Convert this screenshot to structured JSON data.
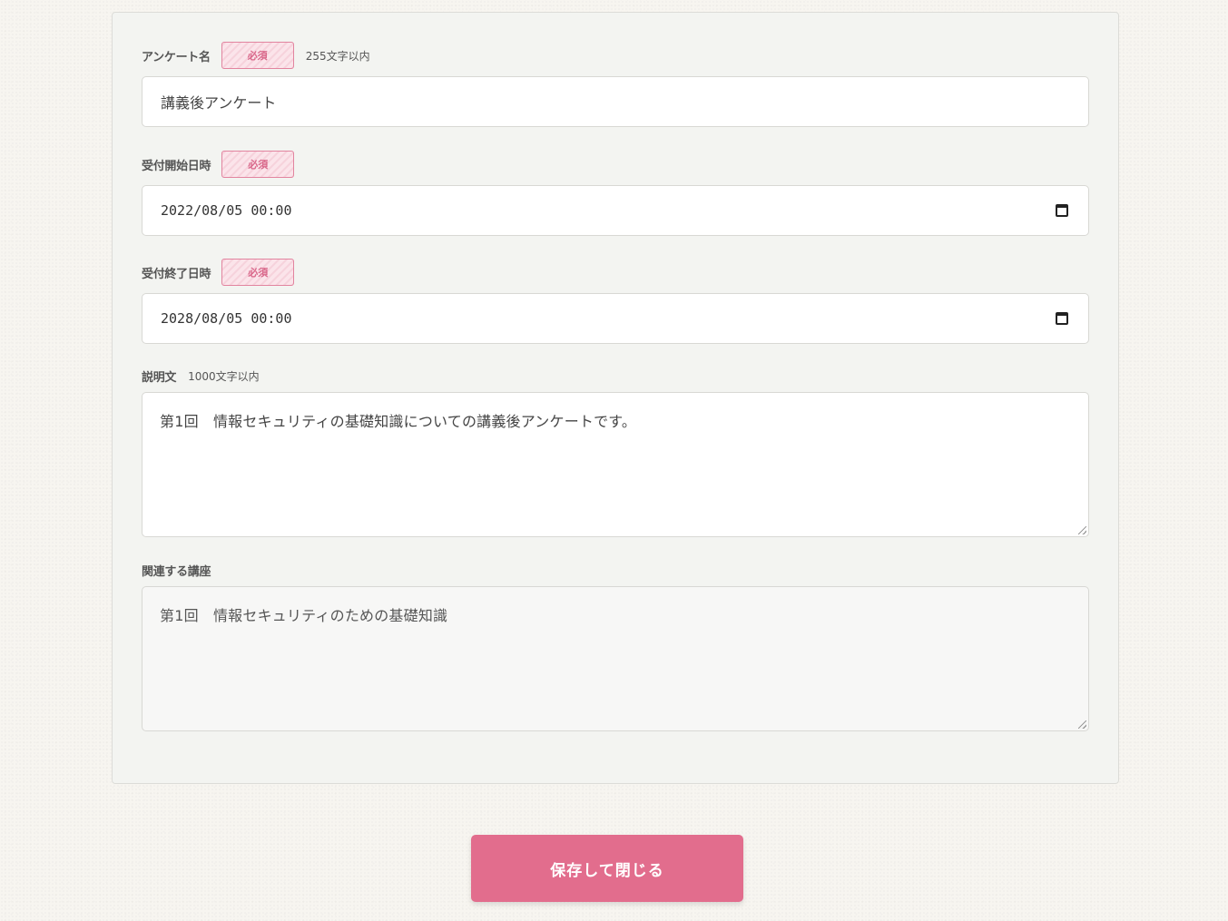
{
  "form": {
    "survey_name": {
      "label": "アンケート名",
      "required_badge": "必須",
      "hint": "255文字以内",
      "value": "講義後アンケート"
    },
    "start_datetime": {
      "label": "受付開始日時",
      "required_badge": "必須",
      "value": "2022/08/05 00:00",
      "icon": "calendar-icon"
    },
    "end_datetime": {
      "label": "受付終了日時",
      "required_badge": "必須",
      "value": "2028/08/05 00:00",
      "icon": "calendar-icon"
    },
    "description": {
      "label": "説明文",
      "hint": "1000文字以内",
      "value": "第1回　情報セキュリティの基礎知識についての講義後アンケートです。"
    },
    "related_course": {
      "label": "関連する講座",
      "value": "第1回　情報セキュリティのための基礎知識"
    }
  },
  "actions": {
    "save_label": "保存して閉じる"
  },
  "colors": {
    "accent": "#e26d8d",
    "badge_border": "#e2849f",
    "panel_bg": "#f3f4f1"
  }
}
